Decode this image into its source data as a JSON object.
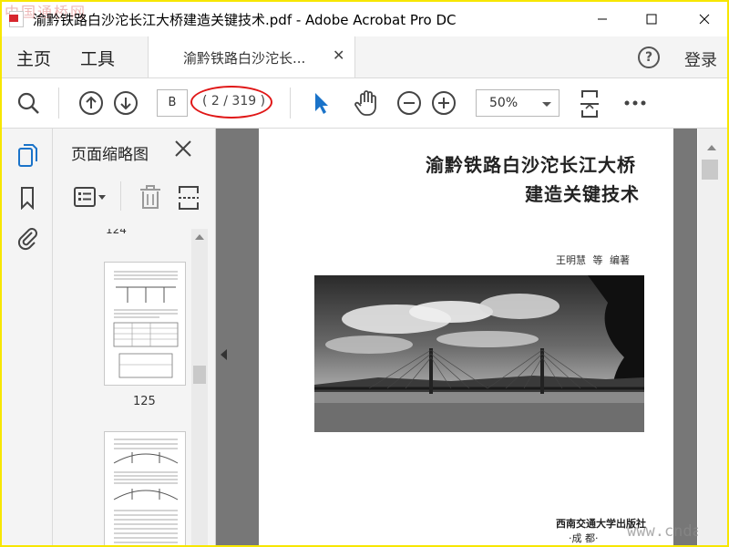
{
  "window": {
    "title": "渝黔铁路白沙沱长江大桥建造关键技术.pdf - Adobe Acrobat Pro DC",
    "watermark_text": "中国通桥网"
  },
  "tabs": {
    "home": "主页",
    "tools": "工具",
    "document": "渝黔铁路白沙沱长...",
    "help": "?",
    "login": "登录"
  },
  "toolbar": {
    "page_input": "B",
    "page_count": "( 2 / 319 )",
    "zoom": "50%"
  },
  "panel": {
    "title": "页面缩略图",
    "thumbnails": [
      {
        "label": "124"
      },
      {
        "label": "125"
      },
      {
        "label": ""
      }
    ]
  },
  "document": {
    "title_line1": "渝黔铁路白沙沱长江大桥",
    "title_line2": "建造关键技术",
    "author": "王明慧  等  编著",
    "publisher": "西南交通大学出版社",
    "city": "·成  都·",
    "watermark": "www.cnda.com"
  },
  "colors": {
    "accent": "#1a73c9",
    "highlight": "#e01717",
    "frame": "#f7e600"
  }
}
